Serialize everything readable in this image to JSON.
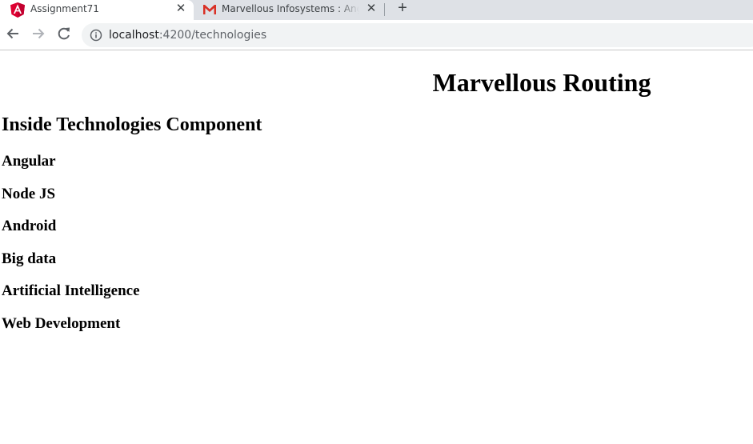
{
  "browser": {
    "tabs": [
      {
        "title": "Assignment71",
        "favicon": "angular-icon",
        "active": true
      },
      {
        "title": "Marvellous Infosystems : Angular",
        "favicon": "gmail-icon",
        "active": false
      }
    ],
    "url": {
      "host": "localhost",
      "path": ":4200/technologies"
    }
  },
  "page": {
    "app_title": "Marvellous Routing",
    "component_title": "Inside Technologies Component",
    "technologies": [
      "Angular",
      "Node JS",
      "Android",
      "Big data",
      "Artificial Intelligence",
      "Web Development"
    ]
  },
  "colors": {
    "tabstrip": "#dee1e6",
    "omnibox": "#f1f3f4",
    "angular": "#dd0031",
    "gmail": "#d93025"
  }
}
